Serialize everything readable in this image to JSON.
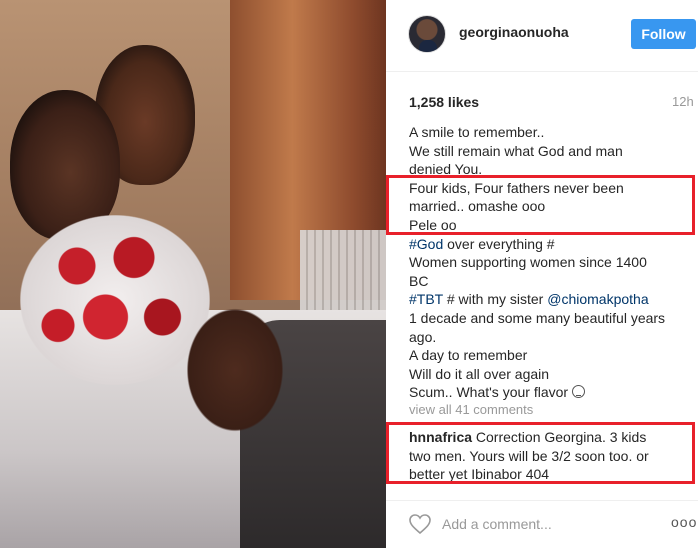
{
  "header": {
    "username": "georginaonuoha",
    "follow_label": "Follow"
  },
  "post": {
    "likes": "1,258 likes",
    "time": "12h",
    "caption_lines": [
      "A smile to remember..",
      "We still remain what God and man",
      "denied You.",
      "Four kids, Four fathers never been",
      "married.. omashe ooo",
      "Pele oo"
    ],
    "hashtag_god": "#God",
    "god_rest": " over everything #",
    "women_line1": "Women supporting women since 1400",
    "women_line2": "BC",
    "hashtag_tbt": "#TBT",
    "tbt_mid": " # with my sister ",
    "mention": "@chiomakpotha",
    "tail_lines": [
      "1 decade and some many beautiful years",
      "ago.",
      "A day to remember",
      "Will do it all over again"
    ],
    "scum_line": "Scum.. What's your flavor ",
    "view_all": "view all 41 comments"
  },
  "comment": {
    "username": "hnnafrica",
    "text_line1": " Correction Georgina. 3 kids",
    "text_line2": "two men. Yours will be 3/2 soon too. or",
    "text_line3": "better yet Ibinabor 404"
  },
  "footer": {
    "placeholder": "Add a comment...",
    "more_label": "ooo"
  },
  "colors": {
    "follow": "#3897f0",
    "link": "#003569",
    "highlight": "#e8202a"
  }
}
